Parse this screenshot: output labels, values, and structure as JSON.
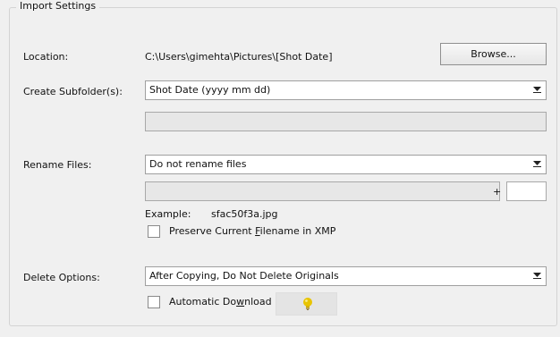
{
  "group": {
    "title": "Import Settings"
  },
  "location": {
    "label": "Location:",
    "path": "C:\\Users\\gimehta\\Pictures\\[Shot Date]",
    "browse_label": "Browse..."
  },
  "subfolder": {
    "label": "Create Subfolder(s):",
    "selected": "Shot Date (yyyy mm dd)",
    "custom_value": ""
  },
  "rename": {
    "label": "Rename Files:",
    "selected": "Do not rename files",
    "text_value": "",
    "plus": "+",
    "number_value": "",
    "example_label": "Example:",
    "example_value": "sfac50f3a.jpg",
    "preserve_label": "Preserve Current Filename in XMP",
    "preserve_checked": false
  },
  "delete": {
    "label": "Delete Options:",
    "selected": "After Copying, Do Not Delete Originals"
  },
  "download": {
    "label": "Automatic Download",
    "checked": false
  },
  "icons": {
    "dropdown": "chevron-down-icon",
    "bulb": "lightbulb-icon"
  },
  "colors": {
    "bulb": "#e8c400"
  }
}
